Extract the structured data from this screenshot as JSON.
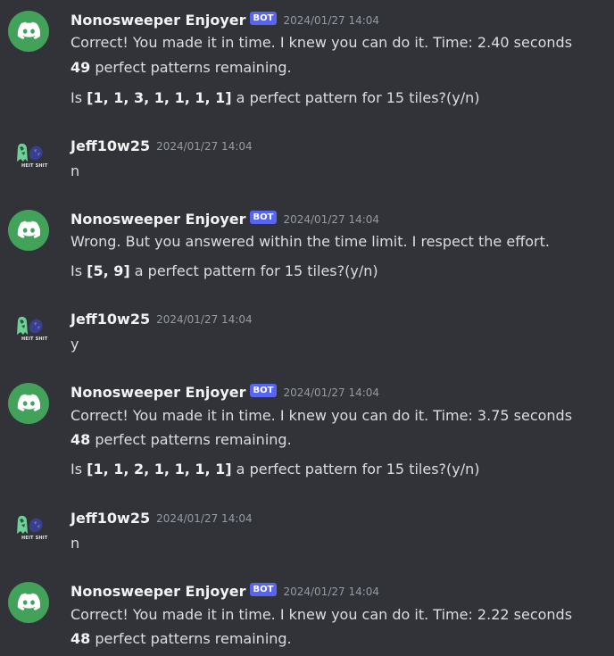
{
  "messages": [
    {
      "author": "Nonosweeper Enjoyer",
      "badge": "BOT",
      "timestamp": "2024/01/27 14:04",
      "line1": "Correct! You made it in time. I knew you can do it.  Time: 2.40 seconds",
      "count": "49",
      "count_suffix": " perfect patterns remaining.",
      "q_prefix": "Is ",
      "pattern": "[1, 1, 3, 1, 1, 1, 1]",
      "q_suffix": " a perfect pattern for 15 tiles?(y/n)"
    },
    {
      "author": "Jeff10w25",
      "timestamp": "2024/01/27 14:04",
      "text": "n",
      "avatar_tag": "HEIT SHIT"
    },
    {
      "author": "Nonosweeper Enjoyer",
      "badge": "BOT",
      "timestamp": "2024/01/27 14:04",
      "line1": "Wrong. But you answered within the time limit. I respect the effort.",
      "q_prefix": "Is ",
      "pattern": "[5, 9]",
      "q_suffix": " a perfect pattern for 15 tiles?(y/n)"
    },
    {
      "author": "Jeff10w25",
      "timestamp": "2024/01/27 14:04",
      "text": "y",
      "avatar_tag": "HEIT SHIT"
    },
    {
      "author": "Nonosweeper Enjoyer",
      "badge": "BOT",
      "timestamp": "2024/01/27 14:04",
      "line1": "Correct! You made it in time. I knew you can do it.  Time: 3.75 seconds",
      "count": "48",
      "count_suffix": " perfect patterns remaining.",
      "q_prefix": "Is ",
      "pattern": "[1, 1, 2, 1, 1, 1, 1]",
      "q_suffix": " a perfect pattern for 15 tiles?(y/n)"
    },
    {
      "author": "Jeff10w25",
      "timestamp": "2024/01/27 14:04",
      "text": "n",
      "avatar_tag": "HEIT SHIT"
    },
    {
      "author": "Nonosweeper Enjoyer",
      "badge": "BOT",
      "timestamp": "2024/01/27 14:04",
      "line1": "Correct! You made it in time. I knew you can do it.  Time: 2.22 seconds",
      "count": "48",
      "count_suffix": " perfect patterns remaining."
    }
  ],
  "colors": {
    "background": "#313338",
    "bot_avatar": "#43a25a",
    "bot_badge": "#5865f2",
    "name": "#f2f3f5",
    "timestamp": "#949ba4",
    "text": "#dbdee1"
  },
  "icons": {
    "bot_avatar": "discord-logo-icon",
    "user_avatar": "ghost-character-icon"
  }
}
